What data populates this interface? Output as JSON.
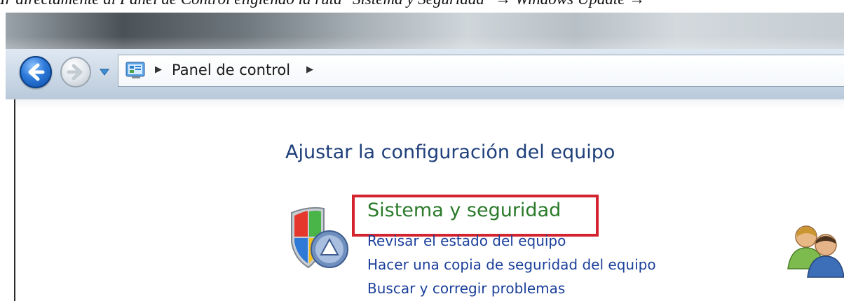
{
  "document": {
    "caption": "Ir directamente al Panel de Control eligiendo la ruta \"Sistema y Seguridad\" → Windows Update →"
  },
  "window": {
    "address_bar": {
      "icon": "control-panel-icon",
      "breadcrumb": [
        "Panel de control"
      ]
    },
    "nav": {
      "back_icon": "back-arrow-icon",
      "forward_icon": "forward-arrow-icon",
      "history_icon": "chevron-down-icon"
    }
  },
  "content": {
    "page_title": "Ajustar la configuración del equipo",
    "categories": [
      {
        "title": "Sistema y seguridad",
        "icon": "shield-icon",
        "highlighted": true,
        "links": [
          "Revisar el estado del equipo",
          "Hacer una copia de seguridad del equipo",
          "Buscar y corregir problemas"
        ]
      }
    ],
    "side_icons": [
      "users-icon",
      "monitor-icon"
    ]
  },
  "colors": {
    "title_blue": "#1e3f7a",
    "category_green": "#2a7a2a",
    "link_blue": "#1b3f9a",
    "highlight_red": "#d3232e"
  }
}
